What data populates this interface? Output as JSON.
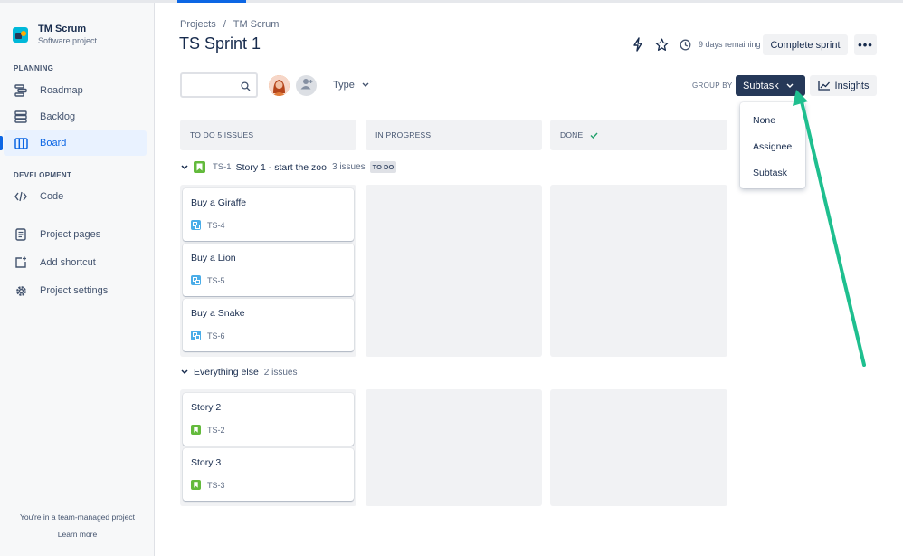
{
  "sidebar": {
    "project_name": "TM Scrum",
    "project_type": "Software project",
    "planning_label": "PLANNING",
    "development_label": "DEVELOPMENT",
    "items": {
      "roadmap": "Roadmap",
      "backlog": "Backlog",
      "board": "Board",
      "code": "Code",
      "project_pages": "Project pages",
      "add_shortcut": "Add shortcut",
      "project_settings": "Project settings"
    },
    "footer_text": "You're in a team-managed project",
    "learn_more": "Learn more"
  },
  "breadcrumb": {
    "projects": "Projects",
    "separator": "/",
    "project": "TM Scrum"
  },
  "header": {
    "title": "TS Sprint 1",
    "days_remaining": "9 days remaining",
    "complete_sprint": "Complete sprint",
    "more": "•••"
  },
  "toolbar": {
    "type_filter": "Type",
    "group_by_label": "GROUP BY",
    "group_by_value": "Subtask",
    "insights": "Insights"
  },
  "group_by_menu": [
    "None",
    "Assignee",
    "Subtask"
  ],
  "columns": {
    "todo": "TO DO 5 ISSUES",
    "in_progress": "IN PROGRESS",
    "done": "DONE"
  },
  "swimlanes": {
    "story1": {
      "key": "TS-1",
      "title": "Story 1 - start the zoo",
      "count": "3 issues",
      "status": "TO DO",
      "cards": [
        {
          "title": "Buy a Giraffe",
          "key": "TS-4"
        },
        {
          "title": "Buy a Lion",
          "key": "TS-5"
        },
        {
          "title": "Buy a Snake",
          "key": "TS-6"
        }
      ]
    },
    "everything_else": {
      "title": "Everything else",
      "count": "2 issues",
      "cards": [
        {
          "title": "Story 2",
          "key": "TS-2"
        },
        {
          "title": "Story 3",
          "key": "TS-3"
        }
      ]
    }
  },
  "colors": {
    "accent": "#0c66e4",
    "group_by_bg": "#253858",
    "story_green": "#63ba3c",
    "subtask_blue": "#4bade8",
    "annotation_arrow": "#1fbf8f"
  }
}
